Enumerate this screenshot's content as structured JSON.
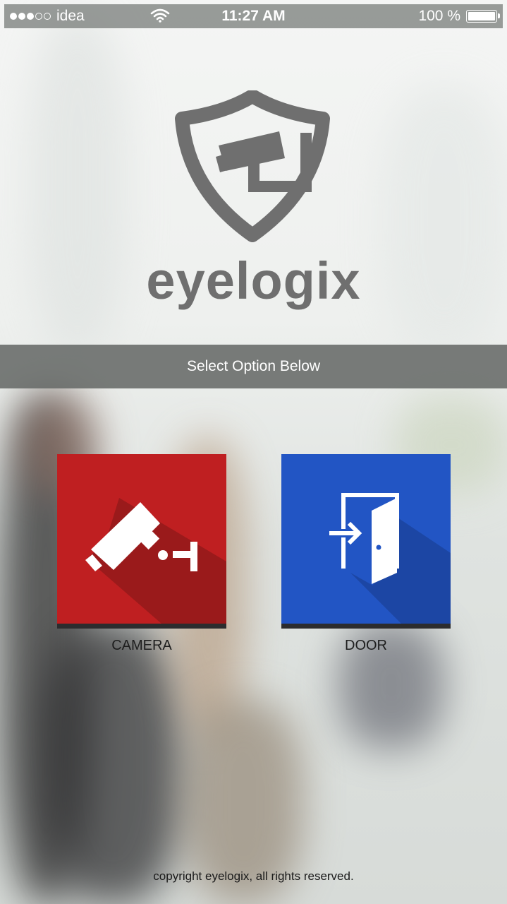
{
  "status_bar": {
    "carrier": "idea",
    "signal_icon": "signal-dots-icon",
    "wifi_icon": "wifi-icon",
    "time": "11:27 AM",
    "battery": "100 %",
    "battery_icon": "battery-icon"
  },
  "brand": {
    "logo_icon": "shield-camera-icon",
    "name": "eyelogix"
  },
  "banner": {
    "text": "Select Option Below"
  },
  "options": [
    {
      "label": "CAMERA",
      "icon": "security-camera-icon",
      "color": "#bf1f21"
    },
    {
      "label": "DOOR",
      "icon": "door-enter-icon",
      "color": "#2255c4"
    }
  ],
  "footer": {
    "copyright": "copyright eyelogix, all rights reserved."
  },
  "colors": {
    "brand_gray": "#6f6f6f",
    "camera_red": "#bf1f21",
    "door_blue": "#2255c4"
  }
}
